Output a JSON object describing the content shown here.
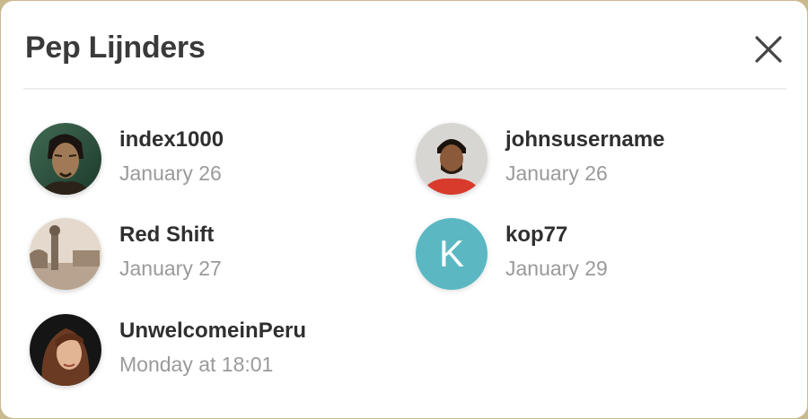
{
  "modal": {
    "title": "Pep Lijnders",
    "close_icon": "close-icon"
  },
  "users": [
    {
      "name": "index1000",
      "date": "January 26",
      "avatar": "photo-portrait"
    },
    {
      "name": "johnsusername",
      "date": "January 26",
      "avatar": "photo-portrait"
    },
    {
      "name": "Red Shift",
      "date": "January 27",
      "avatar": "photo-street-scene"
    },
    {
      "name": "kop77",
      "date": "January 29",
      "avatar_letter": "K",
      "avatar_color": "#5bb8c3"
    },
    {
      "name": "UnwelcomeinPeru",
      "date": "Monday at 18:01",
      "avatar": "photo-portrait"
    }
  ]
}
